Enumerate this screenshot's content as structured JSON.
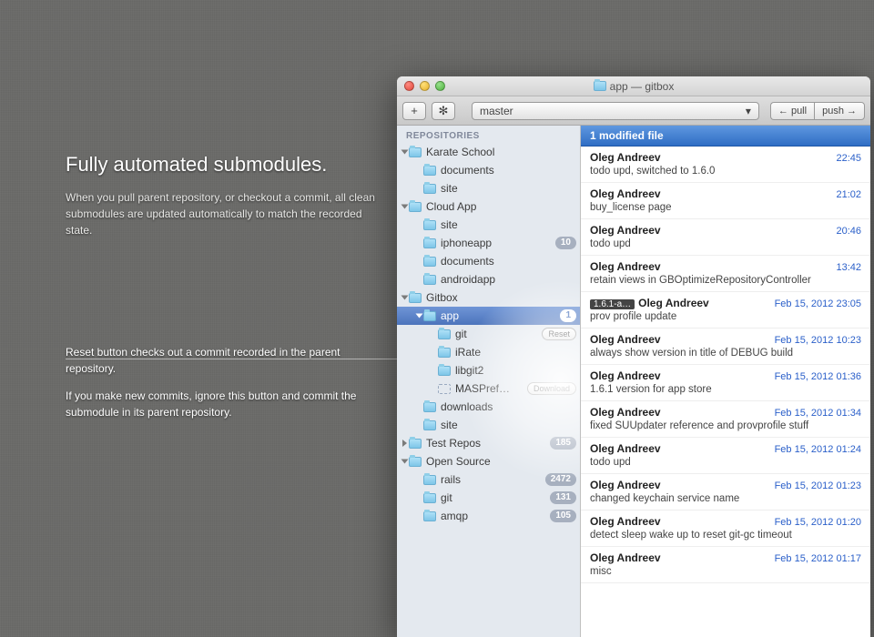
{
  "marketing": {
    "headline": "Fully automated submodules.",
    "body": "When you pull parent repository, or checkout a commit, all clean submodules are updated automatically to match the recorded state."
  },
  "callout": {
    "p1": "Reset button checks out a commit recorded in the parent repository.",
    "p2": "If you make new commits, ignore this button and commit the submodule in its parent repository."
  },
  "window": {
    "title": "app — gitbox",
    "toolbar": {
      "add_label": "+",
      "gear_label": "✻",
      "branch": "master",
      "pull_label": "← pull",
      "push_label": "push →"
    }
  },
  "sidebar": {
    "header": "REPOSITORIES",
    "groups": [
      {
        "name": "Karate School",
        "expanded": true,
        "children": [
          {
            "name": "documents"
          },
          {
            "name": "site"
          }
        ]
      },
      {
        "name": "Cloud App",
        "expanded": true,
        "children": [
          {
            "name": "site"
          },
          {
            "name": "iphoneapp",
            "badge": "10"
          },
          {
            "name": "documents"
          },
          {
            "name": "androidapp"
          }
        ]
      },
      {
        "name": "Gitbox",
        "expanded": true,
        "children": [
          {
            "name": "app",
            "badge": "1",
            "selected": true,
            "expanded": true,
            "children": [
              {
                "name": "git",
                "pill": "Reset"
              },
              {
                "name": "iRate"
              },
              {
                "name": "libgit2"
              },
              {
                "name": "MASPref…",
                "pill": "Download",
                "dashed": true
              }
            ]
          },
          {
            "name": "downloads"
          },
          {
            "name": "site"
          }
        ]
      },
      {
        "name": "Test Repos",
        "expanded": false,
        "collapsedArrow": true,
        "badge": "185"
      },
      {
        "name": "Open Source",
        "expanded": true,
        "children": [
          {
            "name": "rails",
            "badge": "2472"
          },
          {
            "name": "git",
            "badge": "131"
          },
          {
            "name": "amqp",
            "badge": "105"
          }
        ]
      }
    ]
  },
  "status_bar": "1 modified file",
  "commits": [
    {
      "author": "Oleg Andreev",
      "time": "22:45",
      "msg": "todo upd, switched to 1.6.0"
    },
    {
      "author": "Oleg Andreev",
      "time": "21:02",
      "msg": "buy_license page"
    },
    {
      "author": "Oleg Andreev",
      "time": "20:46",
      "msg": "todo upd"
    },
    {
      "author": "Oleg Andreev",
      "time": "13:42",
      "msg": "retain views in GBOptimizeRepositoryController"
    },
    {
      "author": "Oleg Andreev",
      "time": "Feb 15, 2012 23:05",
      "msg": "prov profile update",
      "tag": "1.6.1-a…"
    },
    {
      "author": "Oleg Andreev",
      "time": "Feb 15, 2012 10:23",
      "msg": "always show version in title of DEBUG build"
    },
    {
      "author": "Oleg Andreev",
      "time": "Feb 15, 2012 01:36",
      "msg": "1.6.1 version for app store"
    },
    {
      "author": "Oleg Andreev",
      "time": "Feb 15, 2012 01:34",
      "msg": "fixed SUUpdater reference and provprofile stuff"
    },
    {
      "author": "Oleg Andreev",
      "time": "Feb 15, 2012 01:24",
      "msg": "todo upd"
    },
    {
      "author": "Oleg Andreev",
      "time": "Feb 15, 2012 01:23",
      "msg": "changed keychain service name"
    },
    {
      "author": "Oleg Andreev",
      "time": "Feb 15, 2012 01:20",
      "msg": "detect sleep wake up to reset git-gc timeout"
    },
    {
      "author": "Oleg Andreev",
      "time": "Feb 15, 2012 01:17",
      "msg": "misc"
    }
  ]
}
